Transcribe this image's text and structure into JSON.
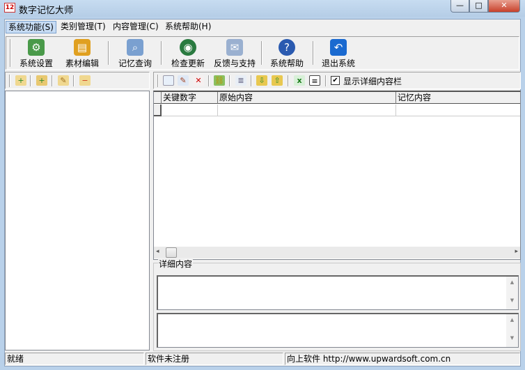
{
  "window": {
    "title": "数字记忆大师",
    "app_icon_text": "12",
    "minimize": "—",
    "maximize": "□",
    "close": "✕"
  },
  "menu": [
    {
      "label": "系统功能(S)"
    },
    {
      "label": "类别管理(T)"
    },
    {
      "label": "内容管理(C)"
    },
    {
      "label": "系统帮助(H)"
    }
  ],
  "toolbar": [
    {
      "label": "系统设置",
      "icon": "settings-icon",
      "glyph": "⚙",
      "color": "#4a9a4a"
    },
    {
      "label": "素材编辑",
      "icon": "books-icon",
      "glyph": "▤",
      "color": "#e0a020"
    },
    {
      "label": "记忆查询",
      "icon": "magnifier-icon",
      "glyph": "🔍",
      "color": "#7aa0d0"
    },
    {
      "label": "检查更新",
      "icon": "globe-icon",
      "glyph": "◉",
      "color": "#2a7a40"
    },
    {
      "label": "反馈与支持",
      "icon": "envelope-icon",
      "glyph": "✉",
      "color": "#9ab0d0"
    },
    {
      "label": "系统帮助",
      "icon": "help-icon",
      "glyph": "?",
      "color": "#2a5ab0"
    },
    {
      "label": "退出系统",
      "icon": "exit-icon",
      "glyph": "↶",
      "color": "#1a6ad0"
    }
  ],
  "category_toolbar": [
    {
      "icon": "folder-add-icon",
      "glyph": "+"
    },
    {
      "icon": "folder-add-sub-icon",
      "glyph": "+"
    },
    {
      "icon": "folder-edit-icon",
      "glyph": "✎"
    },
    {
      "icon": "folder-delete-icon",
      "glyph": "−"
    }
  ],
  "content_toolbar": [
    {
      "icon": "new-document-icon",
      "glyph": "▯",
      "color": "#e8f0fa"
    },
    {
      "icon": "edit-document-icon",
      "glyph": "✎",
      "color": "#dfe8f5"
    },
    {
      "icon": "delete-document-icon",
      "glyph": "✕",
      "color": "#f5e0e0"
    },
    {
      "icon": "link-icon",
      "glyph": "⛓",
      "color": "#d8eac0"
    },
    {
      "icon": "list-icon",
      "glyph": "≣",
      "color": "#e8eef6"
    },
    {
      "icon": "import-icon",
      "glyph": "⇩",
      "color": "#f0e0a0"
    },
    {
      "icon": "export-icon",
      "glyph": "⇧",
      "color": "#f0e0a0"
    },
    {
      "icon": "excel-icon",
      "glyph": "x",
      "color": "#d8f0d8"
    },
    {
      "icon": "notepad-icon",
      "glyph": "≡",
      "color": "#fff"
    }
  ],
  "show_detail_checkbox": {
    "label": "显示详细内容栏",
    "checked": true,
    "mark": "✔"
  },
  "grid": {
    "columns": [
      "关键数字",
      "原始内容",
      "记忆内容"
    ]
  },
  "scroll": {
    "left": "◂",
    "right": "▸",
    "up": "▲",
    "down": "▼"
  },
  "detail": {
    "label": "详细内容"
  },
  "status": {
    "ready": "就绪",
    "registration": "软件未注册",
    "vendor": "向上软件  http://www.upwardsoft.com.cn"
  }
}
